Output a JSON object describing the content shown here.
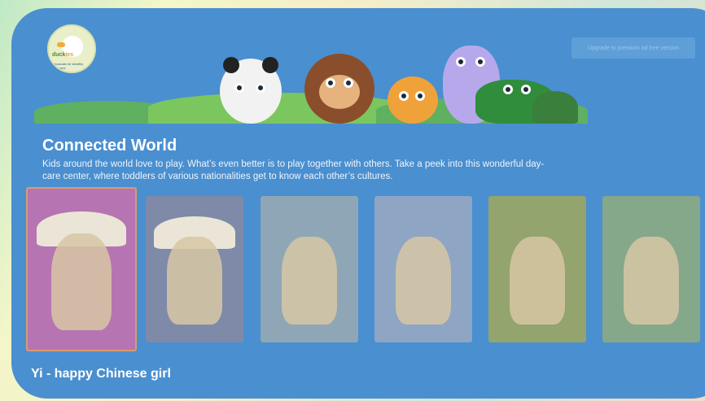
{
  "logo": {
    "word_part1": "duck",
    "word_part2": "ies",
    "ring_text": "musicals for stealthy learners"
  },
  "header": {
    "upgrade_label": "Upgrade to premium ad free version"
  },
  "main": {
    "title": "Connected World",
    "description": "Kids around the world love to play. What’s even better is to play together with others. Take a peek into this wonderful day-care center, where toddlers of various nationalities get to know each other’s cultures.",
    "selected_caption": "Yi - happy Chinese girl"
  },
  "colors": {
    "panel": "#4a8fd0",
    "selected_border": "#d99c6b"
  }
}
